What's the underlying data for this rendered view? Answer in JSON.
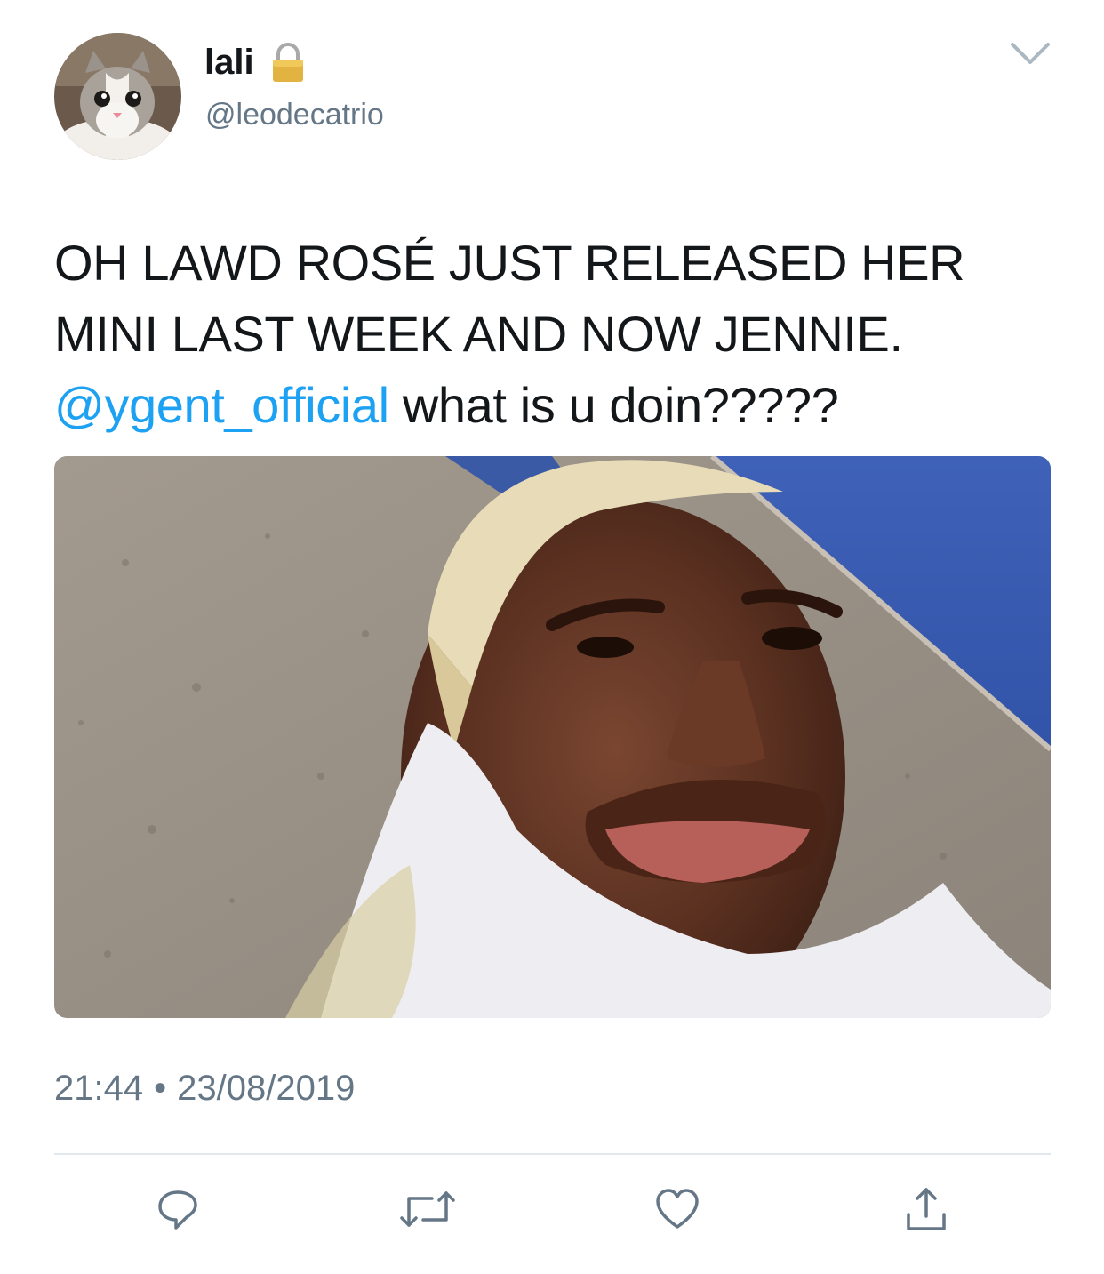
{
  "author": {
    "display_name": "lali",
    "handle": "@leodecatrio",
    "protected_icon": "lock-icon",
    "avatar": "cat-avatar"
  },
  "tweet": {
    "text_lines": [
      "OH LAWD ROSÉ JUST RELEASED HER",
      "MINI LAST WEEK AND NOW JENNIE."
    ],
    "mention": "@ygent_official",
    "text_tail": " what is u doin?????",
    "time": "21:44",
    "separator": "•",
    "date": "23/08/2019",
    "media": "photo-selfie-man"
  },
  "icons": {
    "menu": "chevron-down-icon",
    "reply": "reply-icon",
    "retweet": "retweet-icon",
    "like": "heart-icon",
    "share": "share-icon"
  },
  "colors": {
    "text": "#14171a",
    "secondary": "#657786",
    "link": "#1da1f2",
    "divider": "#e1e8ed",
    "icon": "#657786"
  }
}
